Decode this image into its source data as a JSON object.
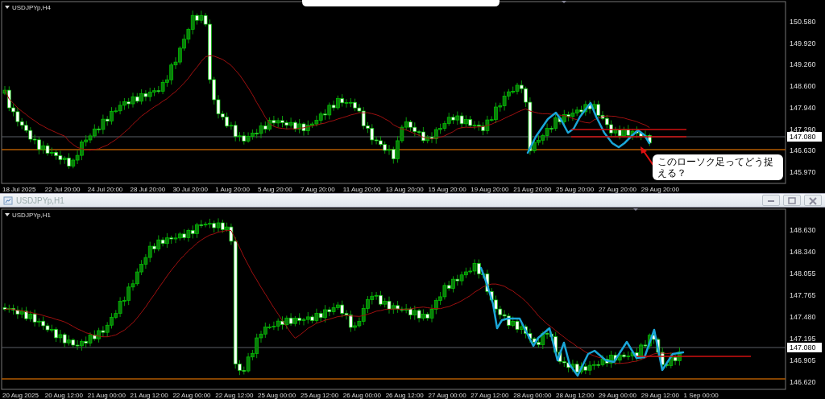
{
  "top_chart": {
    "symbol_label": "USDJPYp,H4",
    "price_labels": [
      "150.580",
      "149.920",
      "149.260",
      "148.600",
      "147.940",
      "147.290",
      "146.630",
      "145.970"
    ],
    "current_price": "147.080",
    "time_labels": [
      "18 Jul 2025",
      "22 Jul 20:00",
      "24 Jul 20:00",
      "28 Jul 20:00",
      "30 Jul 20:00",
      "1 Aug 20:00",
      "5 Aug 20:00",
      "7 Aug 20:00",
      "11 Aug 20:00",
      "13 Aug 20:00",
      "15 Aug 20:00",
      "19 Aug 20:00",
      "21 Aug 20:00",
      "25 Aug 20:00",
      "27 Aug 20:00",
      "29 Aug 20:00"
    ],
    "note": "このローソク足ってどう捉える？"
  },
  "bottom_window": {
    "title": "USDJPYp,H1",
    "chart": {
      "symbol_label": "USDJPYp,H1",
      "price_labels": [
        "148.630",
        "148.340",
        "148.055",
        "147.765",
        "147.480",
        "147.195",
        "146.905",
        "146.620"
      ],
      "current_price": "147.080",
      "time_labels": [
        "20 Aug 2025",
        "20 Aug 12:00",
        "21 Aug 00:00",
        "21 Aug 12:00",
        "22 Aug 00:00",
        "22 Aug 12:00",
        "25 Aug 00:00",
        "25 Aug 12:00",
        "26 Aug 00:00",
        "26 Aug 12:00",
        "27 Aug 00:00",
        "27 Aug 12:00",
        "28 Aug 00:00",
        "28 Aug 12:00",
        "29 Aug 00:00",
        "29 Aug 12:00",
        "1 Sep 00:00"
      ]
    }
  }
}
